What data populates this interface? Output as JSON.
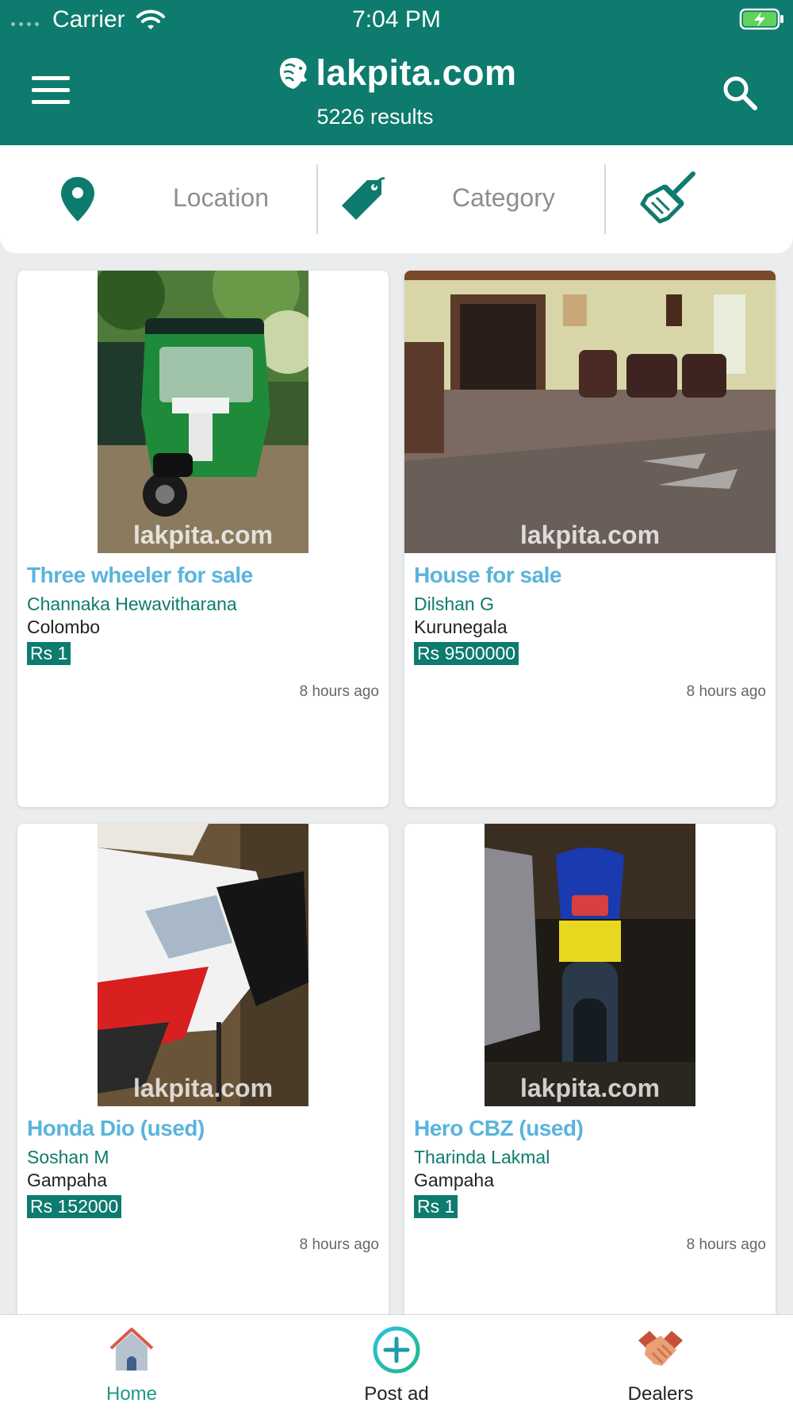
{
  "status_bar": {
    "carrier": "Carrier",
    "time": "7:04 PM"
  },
  "header": {
    "brand": "lakpita.com",
    "results": "5226 results",
    "color": "#0d7b6d"
  },
  "filters": {
    "location_label": "Location",
    "category_label": "Category",
    "location_icon": "location-pin-icon",
    "category_icon": "tag-icon",
    "clear_icon": "broom-icon"
  },
  "listings": [
    {
      "title": "Three wheeler for sale",
      "seller": "Channaka Hewavitharana",
      "location": "Colombo",
      "price": "Rs 1",
      "posted": "8 hours ago",
      "watermark": "lakpita.com"
    },
    {
      "title": "House for sale",
      "seller": "Dilshan G",
      "location": "Kurunegala",
      "price": "Rs 9500000",
      "posted": "8 hours ago",
      "watermark": "lakpita.com"
    },
    {
      "title": "Honda Dio (used)",
      "seller": "Soshan M",
      "location": "Gampaha",
      "price": "Rs 152000",
      "posted": "8 hours ago",
      "watermark": "lakpita.com"
    },
    {
      "title": "Hero CBZ (used)",
      "seller": "Tharinda Lakmal",
      "location": "Gampaha",
      "price": "Rs 1",
      "posted": "8 hours ago",
      "watermark": "lakpita.com"
    }
  ],
  "bottom_nav": {
    "home": "Home",
    "post_ad": "Post ad",
    "dealers": "Dealers",
    "active": "Home"
  },
  "colors": {
    "primary": "#0d7b6d",
    "title_blue": "#5ab4dc",
    "active_nav": "#1a9a8a"
  }
}
